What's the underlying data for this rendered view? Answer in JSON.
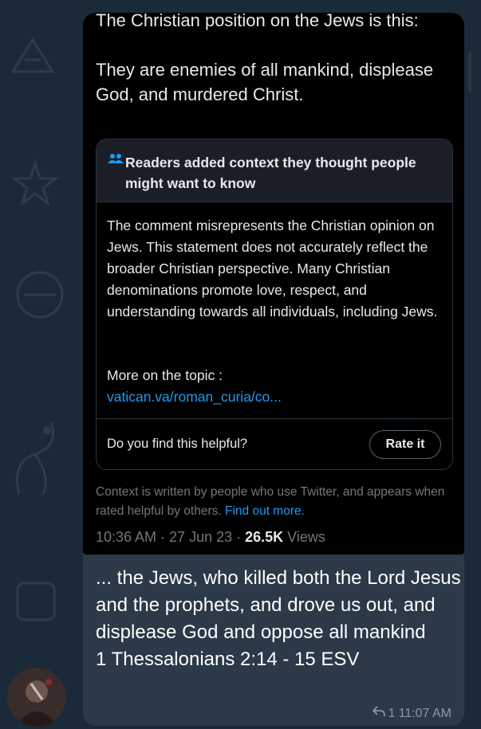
{
  "post": {
    "text": "The Christian position on the Jews is this:\n\nThey are enemies of all mankind, displease God, and murdered Christ."
  },
  "community_note": {
    "header": "Readers added context they thought people might want to know",
    "body": "The comment misrepresents the Christian opinion on Jews.  This statement does not accurately reflect the broader Christian perspective. Many Christian denominations promote love, respect, and understanding towards all individuals, including Jews.",
    "more_label": "More on the topic :",
    "more_link": "vatican.va/roman_curia/co...",
    "helpful_question": "Do you find this helpful?",
    "rate_button": "Rate it"
  },
  "disclaimer": {
    "text": "Context is written by people who use Twitter, and appears when rated helpful by others.",
    "link": "Find out more."
  },
  "tweet_meta": {
    "timestamp": "10:36 AM · 27 Jun 23 · ",
    "views_count": "26.5K",
    "views_label": " Views"
  },
  "message": {
    "caption": "... the Jews, who killed both the Lord Jesus and the prophets, and drove us out, and displease God and oppose all mankind\n1 Thessalonians 2:14 - 15 ESV",
    "reply_count": "1",
    "time": "11:07 AM"
  },
  "colors": {
    "chat_background": "#1b2a38",
    "bubble": "#2b3948",
    "twitter_link": "#1d9bf0",
    "note_header": "#1a1f27"
  },
  "icons": [
    "people-icon",
    "reply-icon",
    "avatar"
  ]
}
